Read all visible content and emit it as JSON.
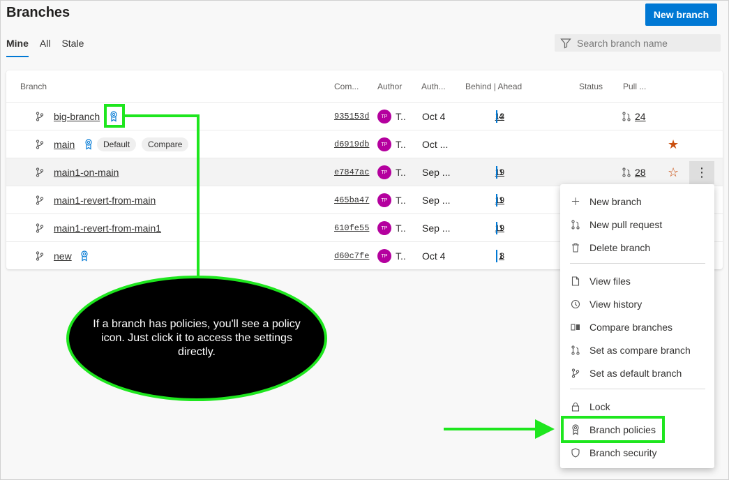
{
  "header": {
    "title": "Branches",
    "new_branch_label": "New branch"
  },
  "tabs": [
    "Mine",
    "All",
    "Stale"
  ],
  "search": {
    "placeholder": "Search branch name"
  },
  "columns": [
    "Branch",
    "Com...",
    "Author",
    "Auth...",
    "Behind | Ahead",
    "Status",
    "Pull ..."
  ],
  "rows": [
    {
      "name": "big-branch",
      "commit": "935153d",
      "initials": "TP",
      "author": "T..",
      "date": "Oct 4",
      "behind": "13",
      "ahead": "4",
      "pr": "24"
    },
    {
      "name": "main",
      "commit": "d6919db",
      "initials": "TP",
      "author": "T..",
      "date": "Oct ...",
      "chip_default": "Default",
      "chip_compare": "Compare"
    },
    {
      "name": "main1-on-main",
      "commit": "e7847ac",
      "initials": "TP",
      "author": "T..",
      "date": "Sep ...",
      "behind": "19",
      "ahead": "1",
      "pr": "28"
    },
    {
      "name": "main1-revert-from-main",
      "commit": "465ba47",
      "initials": "TP",
      "author": "T..",
      "date": "Sep ...",
      "behind": "19",
      "ahead": "1"
    },
    {
      "name": "main1-revert-from-main1",
      "commit": "610fe55",
      "initials": "TP",
      "author": "T..",
      "date": "Sep ...",
      "behind": "19",
      "ahead": "1"
    },
    {
      "name": "new",
      "commit": "d60c7fe",
      "initials": "TP",
      "author": "T..",
      "date": "Oct 4",
      "behind": "8",
      "ahead": "1"
    }
  ],
  "menu": {
    "new_branch": "New branch",
    "new_pr": "New pull request",
    "delete_branch": "Delete branch",
    "view_files": "View files",
    "view_history": "View history",
    "compare_branches": "Compare branches",
    "set_compare": "Set as compare branch",
    "set_default": "Set as default branch",
    "lock": "Lock",
    "branch_policies": "Branch policies",
    "branch_security": "Branch security"
  },
  "callout": {
    "text": "If a branch has policies, you'll see a policy icon. Just click it to access the settings directly."
  },
  "colors": {
    "accent": "#0078d4",
    "highlight": "#1ee61e",
    "avatar": "#b4009e",
    "star": "#ca5010"
  }
}
